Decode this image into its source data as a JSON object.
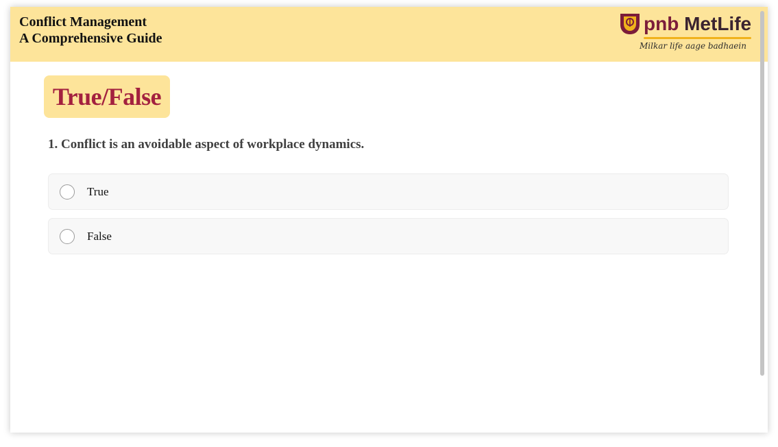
{
  "header": {
    "title_line1": "Conflict Management",
    "title_line2": "A Comprehensive Guide",
    "background_color": "#fde49a"
  },
  "logo": {
    "brand_pnb": "pnb",
    "brand_metlife": "MetLife",
    "tagline": "Milkar life aage badhaein",
    "icon": "pnb-metlife-logo-icon",
    "colors": {
      "pnb": "#7b1c3a",
      "accent": "#f0b21c"
    }
  },
  "section": {
    "title": "True/False",
    "title_color": "#a3213f"
  },
  "question": {
    "text": "1. Conflict is an avoidable aspect of workplace dynamics.",
    "options": [
      {
        "label": "True",
        "selected": false
      },
      {
        "label": "False",
        "selected": false
      }
    ]
  }
}
